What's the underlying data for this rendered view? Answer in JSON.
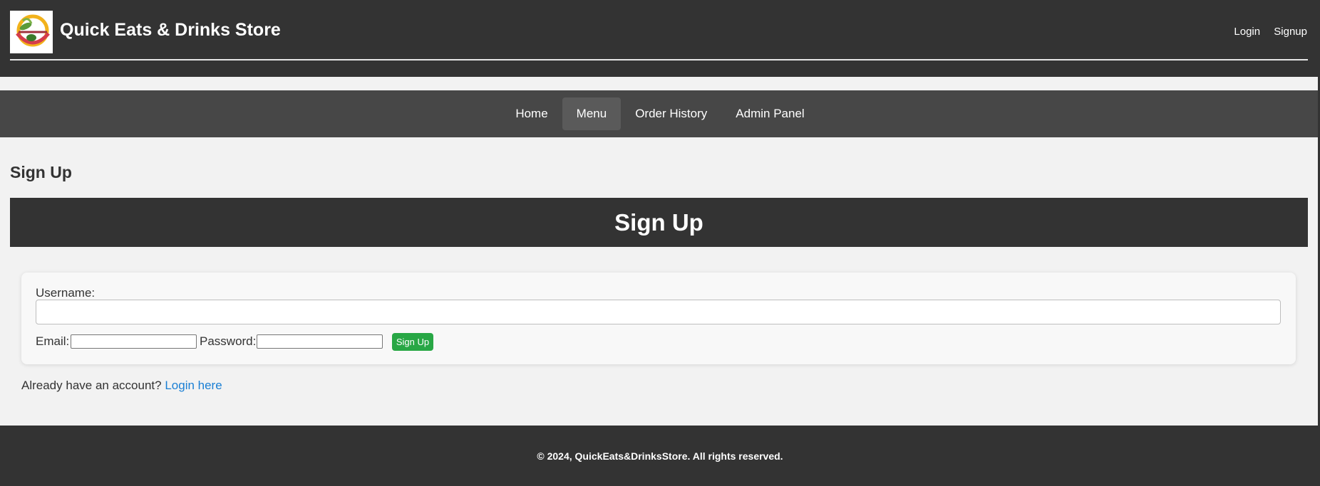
{
  "header": {
    "site_title": "Quick Eats & Drinks Store",
    "login_label": "Login",
    "signup_label": "Signup",
    "logo_icon": "bowl-leaf-logo-icon"
  },
  "nav": {
    "items": [
      {
        "label": "Home",
        "active": false
      },
      {
        "label": "Menu",
        "active": true
      },
      {
        "label": "Order History",
        "active": false
      },
      {
        "label": "Admin Panel",
        "active": false
      }
    ]
  },
  "main": {
    "page_heading": "Sign Up",
    "banner_title": "Sign Up",
    "form": {
      "username_label": "Username:",
      "username_value": "",
      "email_label": "Email:",
      "email_value": "",
      "password_label": "Password:",
      "password_value": "",
      "submit_label": "Sign Up"
    },
    "login_prompt": "Already have an account?",
    "login_link": "Login here"
  },
  "footer": {
    "text": "© 2024, QuickEats&DrinksStore. All rights reserved."
  },
  "colors": {
    "header_bg": "#333333",
    "nav_bg": "#474747",
    "button_green": "#28a745",
    "link_blue": "#1a7fd4"
  }
}
